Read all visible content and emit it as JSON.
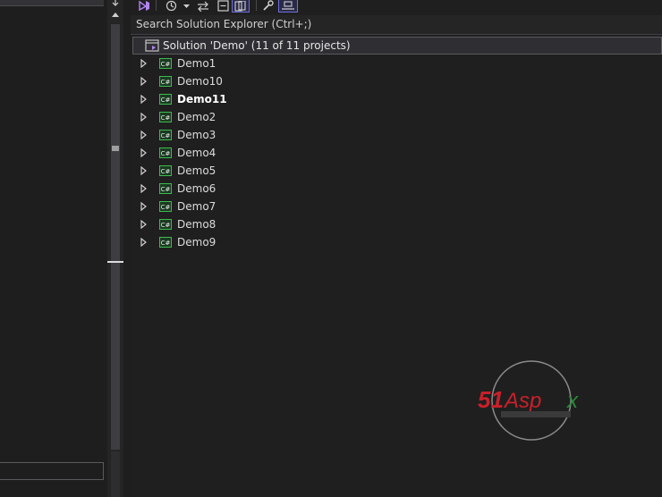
{
  "search": {
    "placeholder": "Search Solution Explorer (Ctrl+;)"
  },
  "toolbar": {
    "buttons": [
      {
        "icon": "vs-sync-icon"
      },
      {
        "icon": "history-icon"
      },
      {
        "icon": "dropdown-arrow-icon"
      },
      {
        "icon": "sync-active-doc-icon"
      },
      {
        "icon": "collapse-all-icon"
      },
      {
        "icon": "show-all-files-icon"
      },
      {
        "icon": "properties-wrench-icon"
      },
      {
        "icon": "preview-selected-icon"
      }
    ]
  },
  "solution": {
    "label": "Solution 'Demo' (11 of 11 projects)"
  },
  "projects": [
    {
      "name": "Demo1",
      "bold": false
    },
    {
      "name": "Demo10",
      "bold": false
    },
    {
      "name": "Demo11",
      "bold": true
    },
    {
      "name": "Demo2",
      "bold": false
    },
    {
      "name": "Demo3",
      "bold": false
    },
    {
      "name": "Demo4",
      "bold": false
    },
    {
      "name": "Demo5",
      "bold": false
    },
    {
      "name": "Demo6",
      "bold": false
    },
    {
      "name": "Demo7",
      "bold": false
    },
    {
      "name": "Demo8",
      "bold": false
    },
    {
      "name": "Demo9",
      "bold": false
    }
  ],
  "watermark": {
    "text": "51Aspx"
  },
  "colors": {
    "background": "#1e1e1e",
    "project_icon": "#3fb950",
    "accent": "#6f6fd8",
    "watermark_red": "#c8202a",
    "watermark_green": "#2e8b3a"
  }
}
